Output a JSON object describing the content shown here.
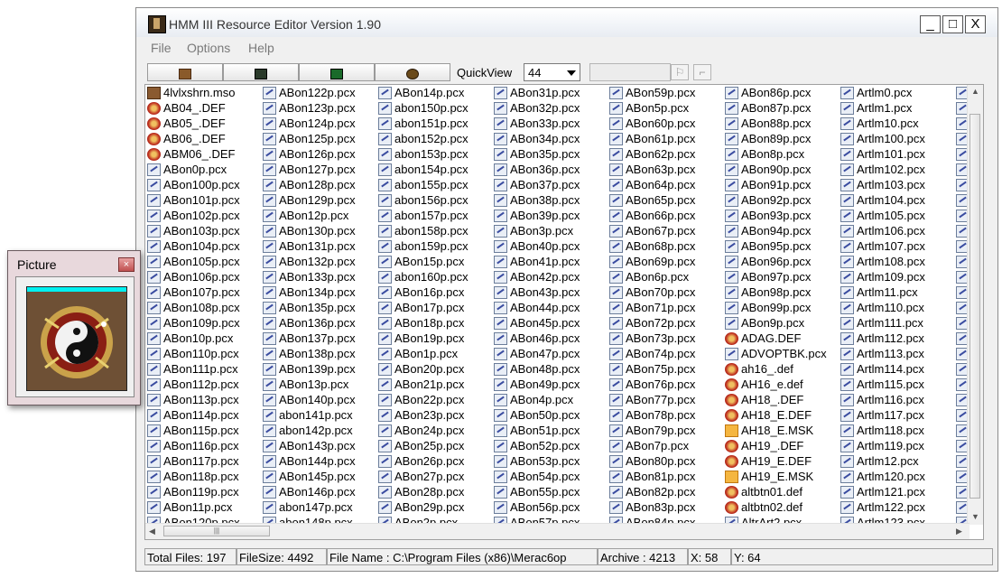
{
  "window": {
    "title": "HMM III Resource Editor  Version 1.90",
    "controls": [
      "_",
      "□",
      "X"
    ]
  },
  "menu": [
    "File",
    "Options",
    "Help"
  ],
  "toolbar": {
    "quickview_label": "QuickView",
    "quickview_value": "44"
  },
  "picture_window": {
    "title": "Picture",
    "close": "×"
  },
  "files": {
    "columns": [
      [
        {
          "name": "4lvlxshrn.mso",
          "type": "mso"
        },
        {
          "name": "AB04_.DEF",
          "type": "def"
        },
        {
          "name": "AB05_.DEF",
          "type": "def"
        },
        {
          "name": "AB06_.DEF",
          "type": "def"
        },
        {
          "name": "ABM06_.DEF",
          "type": "def"
        },
        {
          "name": "ABon0p.pcx",
          "type": "pcx"
        },
        {
          "name": "ABon100p.pcx",
          "type": "pcx"
        },
        {
          "name": "ABon101p.pcx",
          "type": "pcx"
        },
        {
          "name": "ABon102p.pcx",
          "type": "pcx"
        },
        {
          "name": "ABon103p.pcx",
          "type": "pcx"
        },
        {
          "name": "ABon104p.pcx",
          "type": "pcx"
        },
        {
          "name": "ABon105p.pcx",
          "type": "pcx"
        },
        {
          "name": "ABon106p.pcx",
          "type": "pcx"
        },
        {
          "name": "ABon107p.pcx",
          "type": "pcx"
        },
        {
          "name": "ABon108p.pcx",
          "type": "pcx"
        },
        {
          "name": "ABon109p.pcx",
          "type": "pcx"
        },
        {
          "name": "ABon10p.pcx",
          "type": "pcx"
        },
        {
          "name": "ABon110p.pcx",
          "type": "pcx"
        },
        {
          "name": "ABon111p.pcx",
          "type": "pcx"
        },
        {
          "name": "ABon112p.pcx",
          "type": "pcx"
        },
        {
          "name": "ABon113p.pcx",
          "type": "pcx"
        },
        {
          "name": "ABon114p.pcx",
          "type": "pcx"
        },
        {
          "name": "ABon115p.pcx",
          "type": "pcx"
        },
        {
          "name": "ABon116p.pcx",
          "type": "pcx"
        },
        {
          "name": "ABon117p.pcx",
          "type": "pcx"
        },
        {
          "name": "ABon118p.pcx",
          "type": "pcx"
        },
        {
          "name": "ABon119p.pcx",
          "type": "pcx"
        },
        {
          "name": "ABon11p.pcx",
          "type": "pcx"
        },
        {
          "name": "ABon120p.pcx",
          "type": "pcx"
        }
      ],
      [
        {
          "name": "ABon122p.pcx",
          "type": "pcx"
        },
        {
          "name": "ABon123p.pcx",
          "type": "pcx"
        },
        {
          "name": "ABon124p.pcx",
          "type": "pcx"
        },
        {
          "name": "ABon125p.pcx",
          "type": "pcx"
        },
        {
          "name": "ABon126p.pcx",
          "type": "pcx"
        },
        {
          "name": "ABon127p.pcx",
          "type": "pcx"
        },
        {
          "name": "ABon128p.pcx",
          "type": "pcx"
        },
        {
          "name": "ABon129p.pcx",
          "type": "pcx"
        },
        {
          "name": "ABon12p.pcx",
          "type": "pcx"
        },
        {
          "name": "ABon130p.pcx",
          "type": "pcx"
        },
        {
          "name": "ABon131p.pcx",
          "type": "pcx"
        },
        {
          "name": "ABon132p.pcx",
          "type": "pcx"
        },
        {
          "name": "ABon133p.pcx",
          "type": "pcx"
        },
        {
          "name": "ABon134p.pcx",
          "type": "pcx"
        },
        {
          "name": "ABon135p.pcx",
          "type": "pcx"
        },
        {
          "name": "ABon136p.pcx",
          "type": "pcx"
        },
        {
          "name": "ABon137p.pcx",
          "type": "pcx"
        },
        {
          "name": "ABon138p.pcx",
          "type": "pcx"
        },
        {
          "name": "ABon139p.pcx",
          "type": "pcx"
        },
        {
          "name": "ABon13p.pcx",
          "type": "pcx"
        },
        {
          "name": "ABon140p.pcx",
          "type": "pcx"
        },
        {
          "name": "abon141p.pcx",
          "type": "pcx"
        },
        {
          "name": "abon142p.pcx",
          "type": "pcx"
        },
        {
          "name": "ABon143p.pcx",
          "type": "pcx"
        },
        {
          "name": "ABon144p.pcx",
          "type": "pcx"
        },
        {
          "name": "ABon145p.pcx",
          "type": "pcx"
        },
        {
          "name": "ABon146p.pcx",
          "type": "pcx"
        },
        {
          "name": "abon147p.pcx",
          "type": "pcx"
        },
        {
          "name": "abon148p.pcx",
          "type": "pcx"
        }
      ],
      [
        {
          "name": "ABon14p.pcx",
          "type": "pcx"
        },
        {
          "name": "abon150p.pcx",
          "type": "pcx"
        },
        {
          "name": "abon151p.pcx",
          "type": "pcx"
        },
        {
          "name": "abon152p.pcx",
          "type": "pcx"
        },
        {
          "name": "abon153p.pcx",
          "type": "pcx"
        },
        {
          "name": "abon154p.pcx",
          "type": "pcx"
        },
        {
          "name": "abon155p.pcx",
          "type": "pcx"
        },
        {
          "name": "abon156p.pcx",
          "type": "pcx"
        },
        {
          "name": "abon157p.pcx",
          "type": "pcx"
        },
        {
          "name": "abon158p.pcx",
          "type": "pcx"
        },
        {
          "name": "abon159p.pcx",
          "type": "pcx"
        },
        {
          "name": "ABon15p.pcx",
          "type": "pcx"
        },
        {
          "name": "abon160p.pcx",
          "type": "pcx"
        },
        {
          "name": "ABon16p.pcx",
          "type": "pcx"
        },
        {
          "name": "ABon17p.pcx",
          "type": "pcx"
        },
        {
          "name": "ABon18p.pcx",
          "type": "pcx"
        },
        {
          "name": "ABon19p.pcx",
          "type": "pcx"
        },
        {
          "name": "ABon1p.pcx",
          "type": "pcx"
        },
        {
          "name": "ABon20p.pcx",
          "type": "pcx"
        },
        {
          "name": "ABon21p.pcx",
          "type": "pcx"
        },
        {
          "name": "ABon22p.pcx",
          "type": "pcx"
        },
        {
          "name": "ABon23p.pcx",
          "type": "pcx"
        },
        {
          "name": "ABon24p.pcx",
          "type": "pcx"
        },
        {
          "name": "ABon25p.pcx",
          "type": "pcx"
        },
        {
          "name": "ABon26p.pcx",
          "type": "pcx"
        },
        {
          "name": "ABon27p.pcx",
          "type": "pcx"
        },
        {
          "name": "ABon28p.pcx",
          "type": "pcx"
        },
        {
          "name": "ABon29p.pcx",
          "type": "pcx"
        },
        {
          "name": "ABon2p.pcx",
          "type": "pcx"
        }
      ],
      [
        {
          "name": "ABon31p.pcx",
          "type": "pcx"
        },
        {
          "name": "ABon32p.pcx",
          "type": "pcx"
        },
        {
          "name": "ABon33p.pcx",
          "type": "pcx"
        },
        {
          "name": "ABon34p.pcx",
          "type": "pcx"
        },
        {
          "name": "ABon35p.pcx",
          "type": "pcx"
        },
        {
          "name": "ABon36p.pcx",
          "type": "pcx"
        },
        {
          "name": "ABon37p.pcx",
          "type": "pcx"
        },
        {
          "name": "ABon38p.pcx",
          "type": "pcx"
        },
        {
          "name": "ABon39p.pcx",
          "type": "pcx"
        },
        {
          "name": "ABon3p.pcx",
          "type": "pcx"
        },
        {
          "name": "ABon40p.pcx",
          "type": "pcx"
        },
        {
          "name": "ABon41p.pcx",
          "type": "pcx"
        },
        {
          "name": "ABon42p.pcx",
          "type": "pcx"
        },
        {
          "name": "ABon43p.pcx",
          "type": "pcx"
        },
        {
          "name": "ABon44p.pcx",
          "type": "pcx"
        },
        {
          "name": "ABon45p.pcx",
          "type": "pcx"
        },
        {
          "name": "ABon46p.pcx",
          "type": "pcx"
        },
        {
          "name": "ABon47p.pcx",
          "type": "pcx"
        },
        {
          "name": "ABon48p.pcx",
          "type": "pcx"
        },
        {
          "name": "ABon49p.pcx",
          "type": "pcx"
        },
        {
          "name": "ABon4p.pcx",
          "type": "pcx"
        },
        {
          "name": "ABon50p.pcx",
          "type": "pcx"
        },
        {
          "name": "ABon51p.pcx",
          "type": "pcx"
        },
        {
          "name": "ABon52p.pcx",
          "type": "pcx"
        },
        {
          "name": "ABon53p.pcx",
          "type": "pcx"
        },
        {
          "name": "ABon54p.pcx",
          "type": "pcx"
        },
        {
          "name": "ABon55p.pcx",
          "type": "pcx"
        },
        {
          "name": "ABon56p.pcx",
          "type": "pcx"
        },
        {
          "name": "ABon57p.pcx",
          "type": "pcx"
        }
      ],
      [
        {
          "name": "ABon59p.pcx",
          "type": "pcx"
        },
        {
          "name": "ABon5p.pcx",
          "type": "pcx"
        },
        {
          "name": "ABon60p.pcx",
          "type": "pcx"
        },
        {
          "name": "ABon61p.pcx",
          "type": "pcx"
        },
        {
          "name": "ABon62p.pcx",
          "type": "pcx"
        },
        {
          "name": "ABon63p.pcx",
          "type": "pcx"
        },
        {
          "name": "ABon64p.pcx",
          "type": "pcx"
        },
        {
          "name": "ABon65p.pcx",
          "type": "pcx"
        },
        {
          "name": "ABon66p.pcx",
          "type": "pcx"
        },
        {
          "name": "ABon67p.pcx",
          "type": "pcx"
        },
        {
          "name": "ABon68p.pcx",
          "type": "pcx"
        },
        {
          "name": "ABon69p.pcx",
          "type": "pcx"
        },
        {
          "name": "ABon6p.pcx",
          "type": "pcx"
        },
        {
          "name": "ABon70p.pcx",
          "type": "pcx"
        },
        {
          "name": "ABon71p.pcx",
          "type": "pcx"
        },
        {
          "name": "ABon72p.pcx",
          "type": "pcx"
        },
        {
          "name": "ABon73p.pcx",
          "type": "pcx"
        },
        {
          "name": "ABon74p.pcx",
          "type": "pcx"
        },
        {
          "name": "ABon75p.pcx",
          "type": "pcx"
        },
        {
          "name": "ABon76p.pcx",
          "type": "pcx"
        },
        {
          "name": "ABon77p.pcx",
          "type": "pcx"
        },
        {
          "name": "ABon78p.pcx",
          "type": "pcx"
        },
        {
          "name": "ABon79p.pcx",
          "type": "pcx"
        },
        {
          "name": "ABon7p.pcx",
          "type": "pcx"
        },
        {
          "name": "ABon80p.pcx",
          "type": "pcx"
        },
        {
          "name": "ABon81p.pcx",
          "type": "pcx"
        },
        {
          "name": "ABon82p.pcx",
          "type": "pcx"
        },
        {
          "name": "ABon83p.pcx",
          "type": "pcx"
        },
        {
          "name": "ABon84p.pcx",
          "type": "pcx"
        }
      ],
      [
        {
          "name": "ABon86p.pcx",
          "type": "pcx"
        },
        {
          "name": "ABon87p.pcx",
          "type": "pcx"
        },
        {
          "name": "ABon88p.pcx",
          "type": "pcx"
        },
        {
          "name": "ABon89p.pcx",
          "type": "pcx"
        },
        {
          "name": "ABon8p.pcx",
          "type": "pcx"
        },
        {
          "name": "ABon90p.pcx",
          "type": "pcx"
        },
        {
          "name": "ABon91p.pcx",
          "type": "pcx"
        },
        {
          "name": "ABon92p.pcx",
          "type": "pcx"
        },
        {
          "name": "ABon93p.pcx",
          "type": "pcx"
        },
        {
          "name": "ABon94p.pcx",
          "type": "pcx"
        },
        {
          "name": "ABon95p.pcx",
          "type": "pcx"
        },
        {
          "name": "ABon96p.pcx",
          "type": "pcx"
        },
        {
          "name": "ABon97p.pcx",
          "type": "pcx"
        },
        {
          "name": "ABon98p.pcx",
          "type": "pcx"
        },
        {
          "name": "ABon99p.pcx",
          "type": "pcx"
        },
        {
          "name": "ABon9p.pcx",
          "type": "pcx"
        },
        {
          "name": "ADAG.DEF",
          "type": "def"
        },
        {
          "name": "ADVOPTBK.pcx",
          "type": "pcx"
        },
        {
          "name": "ah16_.def",
          "type": "def"
        },
        {
          "name": "AH16_e.def",
          "type": "def"
        },
        {
          "name": "AH18_.DEF",
          "type": "def"
        },
        {
          "name": "AH18_E.DEF",
          "type": "def"
        },
        {
          "name": "AH18_E.MSK",
          "type": "msk"
        },
        {
          "name": "AH19_.DEF",
          "type": "def"
        },
        {
          "name": "AH19_E.DEF",
          "type": "def"
        },
        {
          "name": "AH19_E.MSK",
          "type": "msk"
        },
        {
          "name": "altbtn01.def",
          "type": "def"
        },
        {
          "name": "altbtn02.def",
          "type": "def"
        },
        {
          "name": "AltrArt2.pcx",
          "type": "pcx"
        }
      ],
      [
        {
          "name": "Artlm0.pcx",
          "type": "pcx"
        },
        {
          "name": "Artlm1.pcx",
          "type": "pcx"
        },
        {
          "name": "Artlm10.pcx",
          "type": "pcx"
        },
        {
          "name": "Artlm100.pcx",
          "type": "pcx"
        },
        {
          "name": "Artlm101.pcx",
          "type": "pcx"
        },
        {
          "name": "Artlm102.pcx",
          "type": "pcx"
        },
        {
          "name": "Artlm103.pcx",
          "type": "pcx"
        },
        {
          "name": "Artlm104.pcx",
          "type": "pcx"
        },
        {
          "name": "Artlm105.pcx",
          "type": "pcx"
        },
        {
          "name": "Artlm106.pcx",
          "type": "pcx"
        },
        {
          "name": "Artlm107.pcx",
          "type": "pcx"
        },
        {
          "name": "Artlm108.pcx",
          "type": "pcx"
        },
        {
          "name": "Artlm109.pcx",
          "type": "pcx"
        },
        {
          "name": "Artlm11.pcx",
          "type": "pcx"
        },
        {
          "name": "Artlm110.pcx",
          "type": "pcx"
        },
        {
          "name": "Artlm111.pcx",
          "type": "pcx"
        },
        {
          "name": "Artlm112.pcx",
          "type": "pcx"
        },
        {
          "name": "Artlm113.pcx",
          "type": "pcx"
        },
        {
          "name": "Artlm114.pcx",
          "type": "pcx"
        },
        {
          "name": "Artlm115.pcx",
          "type": "pcx"
        },
        {
          "name": "Artlm116.pcx",
          "type": "pcx"
        },
        {
          "name": "Artlm117.pcx",
          "type": "pcx"
        },
        {
          "name": "Artlm118.pcx",
          "type": "pcx"
        },
        {
          "name": "Artlm119.pcx",
          "type": "pcx"
        },
        {
          "name": "Artlm12.pcx",
          "type": "pcx"
        },
        {
          "name": "Artlm120.pcx",
          "type": "pcx"
        },
        {
          "name": "Artlm121.pcx",
          "type": "pcx"
        },
        {
          "name": "Artlm122.pcx",
          "type": "pcx"
        },
        {
          "name": "Artlm123.pcx",
          "type": "pcx"
        }
      ]
    ]
  },
  "status": {
    "total_files": "Total Files: 197",
    "file_size": "FileSize: 4492",
    "file_name": "File Name : C:\\Program Files (x86)\\Мегас6ор",
    "archive": "Archive : 4213",
    "x": "X: 58",
    "y": "Y: 64"
  }
}
